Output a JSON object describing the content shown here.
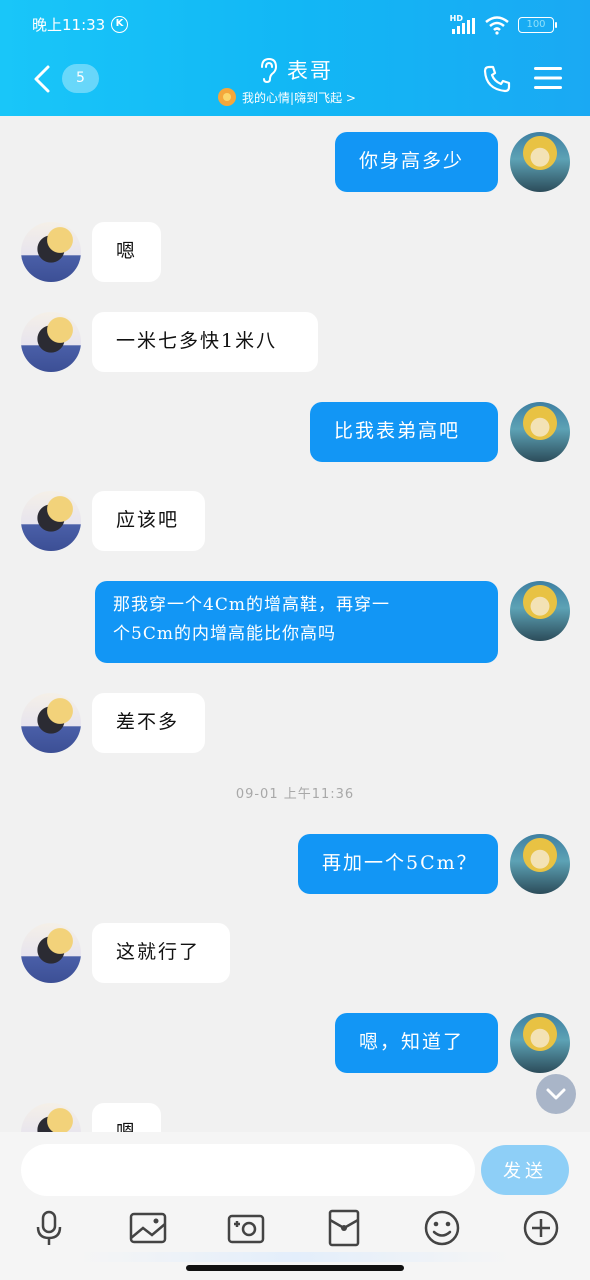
{
  "status_bar": {
    "time": "晚上11:33",
    "k_badge": "K",
    "network": "HD",
    "battery": "100"
  },
  "header": {
    "back_count": "5",
    "title": "表哥",
    "subtitle": "我的心情|嗨到飞起 >",
    "icons": {
      "back": "chevron-left-icon",
      "ear": "ear-icon",
      "phone": "phone-icon",
      "menu": "menu-icon",
      "mood": "sun-icon"
    }
  },
  "messages": [
    {
      "side": "right",
      "text": "你身高多少"
    },
    {
      "side": "left",
      "text": "嗯"
    },
    {
      "side": "left",
      "text": "一米七多快1米八"
    },
    {
      "side": "right",
      "text": "比我表弟高吧"
    },
    {
      "side": "left",
      "text": "应该吧"
    },
    {
      "side": "right",
      "line1": "那我穿一个4Cm的增高鞋，再穿一",
      "line2": "个5Cm的内增高能比你高吗"
    },
    {
      "side": "left",
      "text": "差不多"
    },
    {
      "side": "right",
      "text": "再加一个5Cm？"
    },
    {
      "side": "left",
      "text": "这就行了"
    },
    {
      "side": "right",
      "text": "嗯，知道了"
    },
    {
      "side": "left",
      "text": "嗯"
    }
  ],
  "timestamp": "09-01 上午11:36",
  "input": {
    "placeholder": "",
    "send_label": "发送"
  },
  "toolbar": [
    "microphone-icon",
    "image-icon",
    "camera-icon",
    "red-packet-icon",
    "emoji-icon",
    "plus-icon"
  ],
  "colors": {
    "header": "#12b7f5",
    "bubble_right": "#1296f5",
    "bubble_left": "#ffffff",
    "background": "#f1f1f1",
    "send": "#8ecff7"
  }
}
